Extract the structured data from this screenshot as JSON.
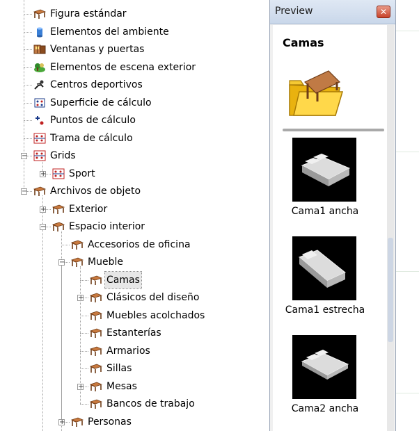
{
  "tree": {
    "items": [
      {
        "label": "Figura estándar",
        "icon": "table-icon"
      },
      {
        "label": "Elementos del ambiente",
        "icon": "cylinder-icon"
      },
      {
        "label": "Ventanas y puertas",
        "icon": "window-icon"
      },
      {
        "label": "Elementos de escena exterior",
        "icon": "tree-icon"
      },
      {
        "label": "Centros deportivos",
        "icon": "sport-icon"
      },
      {
        "label": "Superficie de cálculo",
        "icon": "calc-surface-icon"
      },
      {
        "label": "Puntos de cálculo",
        "icon": "calc-points-icon"
      },
      {
        "label": "Trama de cálculo",
        "icon": "calc-grid-icon"
      },
      {
        "label": "Grids",
        "icon": "calc-grid-icon",
        "expander": "-"
      },
      {
        "label": "Sport",
        "icon": "calc-grid-icon",
        "expander": "+"
      },
      {
        "label": "Archivos de objeto",
        "icon": "table-icon",
        "expander": "-"
      },
      {
        "label": "Exterior",
        "icon": "table-icon",
        "expander": "+"
      },
      {
        "label": "Espacio interior",
        "icon": "table-icon",
        "expander": "-"
      },
      {
        "label": "Accesorios de oficina",
        "icon": "table-icon"
      },
      {
        "label": "Mueble",
        "icon": "table-icon",
        "expander": "-"
      },
      {
        "label": "Camas",
        "icon": "table-icon",
        "selected": true
      },
      {
        "label": "Clásicos del diseño",
        "icon": "table-icon",
        "expander": "+"
      },
      {
        "label": "Muebles acolchados",
        "icon": "table-icon"
      },
      {
        "label": "Estanterías",
        "icon": "table-icon"
      },
      {
        "label": "Armarios",
        "icon": "table-icon"
      },
      {
        "label": "Sillas",
        "icon": "table-icon"
      },
      {
        "label": "Mesas",
        "icon": "table-icon",
        "expander": "+"
      },
      {
        "label": "Bancos de trabajo",
        "icon": "table-icon"
      },
      {
        "label": "Personas",
        "icon": "table-icon",
        "expander": "+"
      }
    ]
  },
  "preview": {
    "title": "Preview",
    "close_icon": "close-icon",
    "category": "Camas",
    "items": [
      {
        "label": "Cama1 ancha"
      },
      {
        "label": "Cama1 estrecha"
      },
      {
        "label": "Cama2 ancha"
      }
    ]
  },
  "colors": {
    "selection": "#e7e7e7",
    "table_brown": "#a0522d",
    "close_red": "#c8432b"
  }
}
